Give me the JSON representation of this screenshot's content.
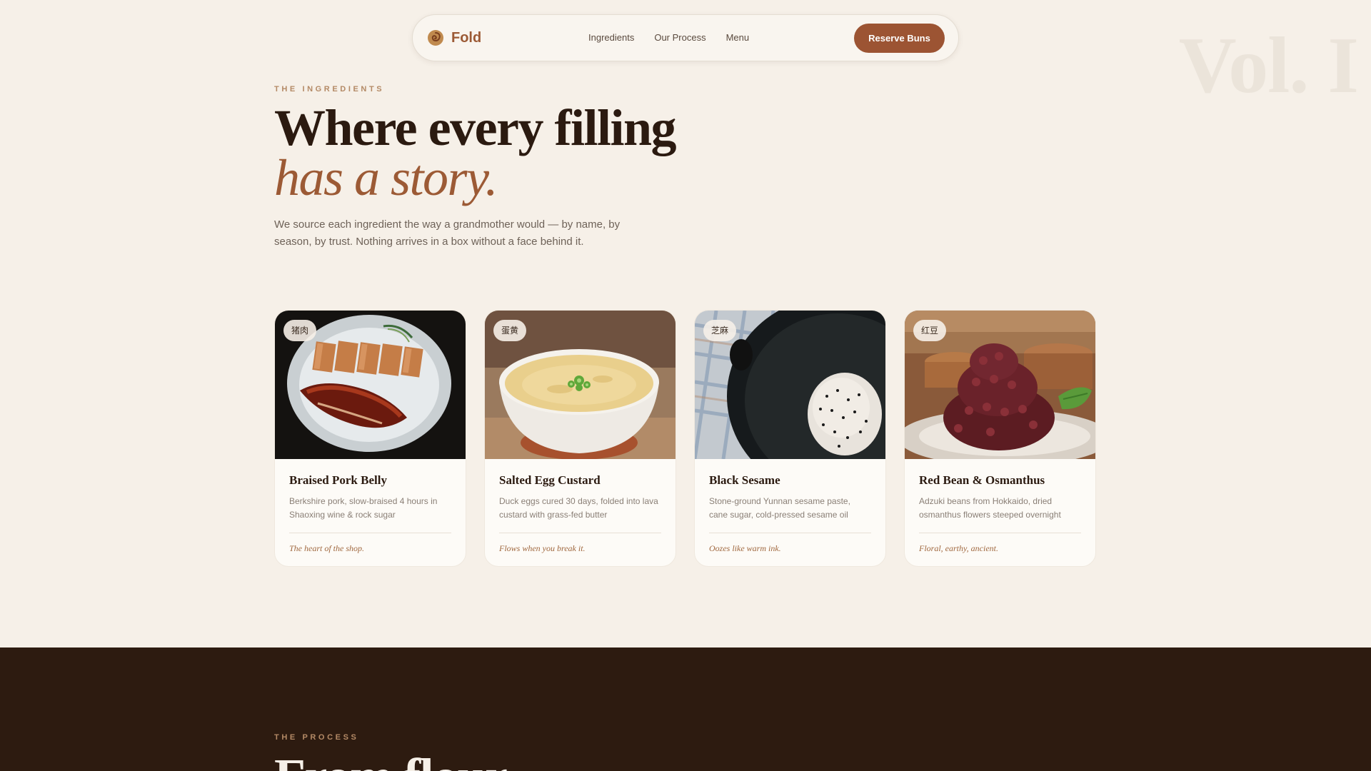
{
  "watermark": "Vol. I",
  "nav": {
    "brand": "Fold",
    "links": [
      "Ingredients",
      "Our Process",
      "Menu"
    ],
    "cta": "Reserve Buns"
  },
  "hero": {
    "eyebrow": "THE INGREDIENTS",
    "headline_line1": "Where every filling",
    "headline_line2": "has a story.",
    "lead": "We source each ingredient the way a grandmother would — by name, by season, by trust. Nothing arrives in a box without a face behind it."
  },
  "cards": [
    {
      "tag": "猪肉",
      "title": "Braised Pork Belly",
      "desc": "Berkshire pork, slow-braised 4 hours in Shaoxing wine & rock sugar",
      "note": "The heart of the shop."
    },
    {
      "tag": "蛋黄",
      "title": "Salted Egg Custard",
      "desc": "Duck eggs cured 30 days, folded into lava custard with grass-fed butter",
      "note": "Flows when you break it."
    },
    {
      "tag": "芝麻",
      "title": "Black Sesame",
      "desc": "Stone-ground Yunnan sesame paste, cane sugar, cold-pressed sesame oil",
      "note": "Oozes like warm ink."
    },
    {
      "tag": "红豆",
      "title": "Red Bean & Osmanthus",
      "desc": "Adzuki beans from Hokkaido, dried osmanthus flowers steeped overnight",
      "note": "Floral, earthy, ancient."
    }
  ],
  "process": {
    "eyebrow": "THE PROCESS",
    "headline": "From flour"
  },
  "colors": {
    "background": "#f6f0e8",
    "accent": "#9c5433",
    "dark": "#2d1b10",
    "eyebrow": "#b48a66"
  },
  "icons": {
    "logo": "bun-swirl-icon"
  }
}
